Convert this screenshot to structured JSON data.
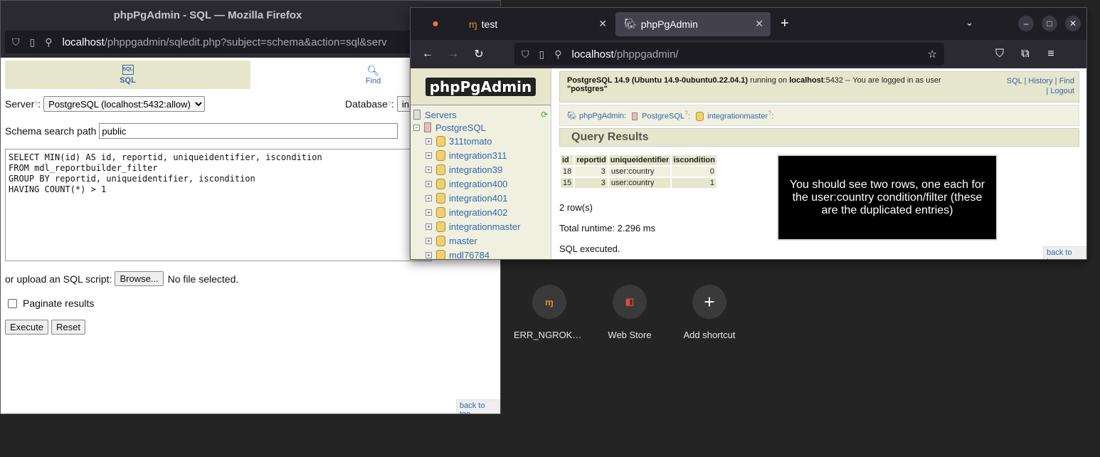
{
  "newtab": {
    "shortcuts": [
      {
        "label": "ERR_NGROK_...",
        "icon": "ngrok-icon",
        "glyph": "ɱ"
      },
      {
        "label": "Web Store",
        "icon": "web-store-icon",
        "glyph": "◧"
      },
      {
        "label": "Add shortcut",
        "icon": "plus-icon",
        "glyph": "+"
      }
    ]
  },
  "win1": {
    "title": "phpPgAdmin - SQL — Mozilla Firefox",
    "url_host": "localhost",
    "url_path": "/phppgadmin/sqledit.php?subject=schema&action=sql&serv",
    "tabs": {
      "sql": "SQL",
      "find": "Find"
    },
    "server_label": "Server",
    "server_value": "PostgreSQL (localhost:5432:allow)",
    "database_label": "Database",
    "database_value": "in",
    "schema_label": "Schema search path",
    "schema_value": "public",
    "sql_text": "SELECT MIN(id) AS id, reportid, uniqueidentifier, iscondition\nFROM mdl_reportbuilder_filter\nGROUP BY reportid, uniqueidentifier, iscondition\nHAVING COUNT(*) > 1",
    "upload_label": "or upload an SQL script:",
    "browse_label": "Browse...",
    "no_file": "No file selected.",
    "paginate_label": "Paginate results",
    "execute_label": "Execute",
    "reset_label": "Reset",
    "back_to_top": "back to top"
  },
  "win2": {
    "tab1": "test",
    "tab2": "phpPgAdmin",
    "url_host": "localhost",
    "url_path": "/phppgadmin/",
    "logo": "phpPgAdmin",
    "tree": {
      "servers": "Servers",
      "postgres": "PostgreSQL",
      "databases": [
        "311tomato",
        "integration311",
        "integration39",
        "integration400",
        "integration401",
        "integration402",
        "integrationmaster",
        "master",
        "mdl76784"
      ]
    },
    "info_text_1": "PostgreSQL 14.9 (Ubuntu 14.9-0ubuntu0.22.04.1)",
    "info_text_2": "running on",
    "info_host": "localhost",
    "info_text_3": ":5432 -- You are logged in as user",
    "info_user": "\"postgres\"",
    "links": {
      "sql": "SQL",
      "history": "History",
      "find": "Find",
      "logout": "Logout"
    },
    "crumbs": {
      "a": "phpPgAdmin:",
      "b": "PostgreSQL",
      "c": "integrationmaster"
    },
    "query_title": "Query Results",
    "table": {
      "headers": [
        "id",
        "reportid",
        "uniqueidentifier",
        "iscondition"
      ],
      "rows": [
        [
          "18",
          "3",
          "user:country",
          "0"
        ],
        [
          "15",
          "3",
          "user:country",
          "1"
        ]
      ]
    },
    "row_count": "2 row(s)",
    "runtime": "Total runtime: 2.296 ms",
    "executed": "SQL executed.",
    "note": "You should see two rows, one each for the user:country condition/filter (these are the duplicated entries)",
    "back_to_top": "back to top"
  }
}
